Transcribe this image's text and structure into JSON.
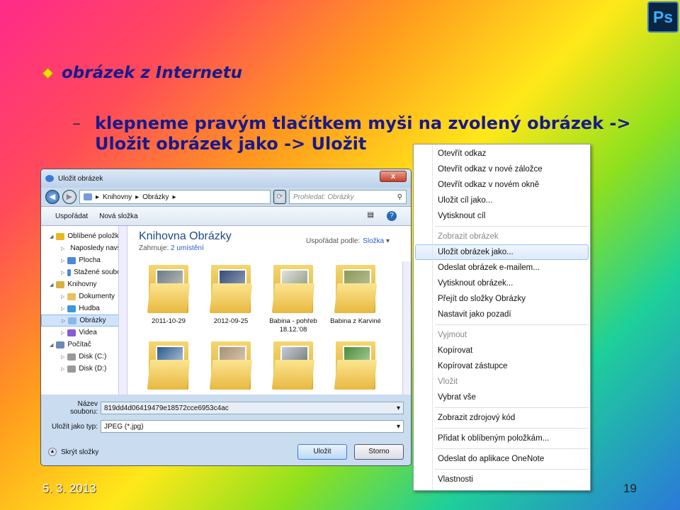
{
  "slide": {
    "title": "obrázek z Internetu",
    "subtitle_line1": "klepneme pravým tlačítkem myši na zvolený obrázek ->",
    "subtitle_line2": "Uložit obrázek jako -> Uložit",
    "dash": "–",
    "date": "5. 3. 2013",
    "page": "19",
    "ps_logo": "Ps"
  },
  "dialog": {
    "title": "Uložit obrázek",
    "breadcrumb": [
      "Knihovny",
      "Obrázky"
    ],
    "search_placeholder": "Prohledat: Obrázky",
    "toolbar": {
      "organize": "Uspořádat",
      "new_folder": "Nová složka"
    },
    "nav": [
      {
        "label": "Oblíbené položky",
        "level": 1
      },
      {
        "label": "Naposledy navštívené",
        "level": 2
      },
      {
        "label": "Plocha",
        "level": 2
      },
      {
        "label": "Stažené soubory",
        "level": 2
      },
      {
        "label": "Knihovny",
        "level": 1
      },
      {
        "label": "Dokumenty",
        "level": 2
      },
      {
        "label": "Hudba",
        "level": 2
      },
      {
        "label": "Obrázky",
        "level": 2
      },
      {
        "label": "Videa",
        "level": 2
      },
      {
        "label": "Počítač",
        "level": 1
      },
      {
        "label": "Disk (C:)",
        "level": 2
      },
      {
        "label": "Disk (D:)",
        "level": 2
      }
    ],
    "library_title": "Knihovna Obrázky",
    "includes_label": "Zahrnuje:",
    "includes_value": "2 umístění",
    "arrange_label": "Uspořádat podle:",
    "arrange_value": "Složka",
    "folders": [
      "2011-10-29",
      "2012-09-25",
      "Babina - pohřeb 18.12.'08",
      "Babina z Karviné",
      "",
      "",
      "",
      ""
    ],
    "filename_label": "Název souboru:",
    "filename_value": "819dd4d06419479e18572cce6953c4ac",
    "filetype_label": "Uložit jako typ:",
    "filetype_value": "JPEG (*.jpg)",
    "hide_folders": "Skrýt složky",
    "save_button": "Uložit",
    "cancel_button": "Storno",
    "close_glyph": "x"
  },
  "context_menu": [
    {
      "label": "Otevřít odkaz",
      "state": "normal"
    },
    {
      "label": "Otevřít odkaz v nové záložce",
      "state": "normal"
    },
    {
      "label": "Otevřít odkaz v novém okně",
      "state": "normal"
    },
    {
      "label": "Uložit cíl jako...",
      "state": "normal"
    },
    {
      "label": "Vytisknout cíl",
      "state": "normal"
    },
    {
      "sep": true
    },
    {
      "label": "Zobrazit obrázek",
      "state": "disabled"
    },
    {
      "label": "Uložit obrázek jako...",
      "state": "highlighted"
    },
    {
      "label": "Odeslat obrázek e-mailem...",
      "state": "normal"
    },
    {
      "label": "Vytisknout obrázek...",
      "state": "normal"
    },
    {
      "label": "Přejít do složky Obrázky",
      "state": "normal"
    },
    {
      "label": "Nastavit jako pozadí",
      "state": "normal"
    },
    {
      "sep": true
    },
    {
      "label": "Vyjmout",
      "state": "disabled"
    },
    {
      "label": "Kopírovat",
      "state": "normal"
    },
    {
      "label": "Kopírovat zástupce",
      "state": "normal"
    },
    {
      "label": "Vložit",
      "state": "disabled"
    },
    {
      "label": "Vybrat vše",
      "state": "normal"
    },
    {
      "sep": true
    },
    {
      "label": "Zobrazit zdrojový kód",
      "state": "normal"
    },
    {
      "sep": true
    },
    {
      "label": "Přidat k oblíbeným položkám...",
      "state": "normal"
    },
    {
      "sep": true
    },
    {
      "label": "Odeslat do aplikace OneNote",
      "state": "normal"
    },
    {
      "sep": true
    },
    {
      "label": "Vlastnosti",
      "state": "normal"
    }
  ]
}
